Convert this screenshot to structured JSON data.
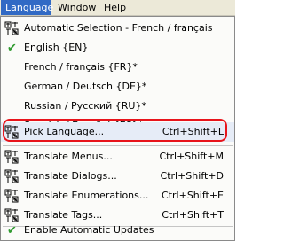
{
  "menubar": {
    "items": [
      "Language",
      "Window",
      "Help"
    ]
  },
  "menu": {
    "items": [
      {
        "icon": "language-icon",
        "label": "Automatic Selection - French / français",
        "shortcut": ""
      },
      {
        "icon": "check-icon",
        "label": "English  {EN}",
        "shortcut": ""
      },
      {
        "icon": "",
        "label": "French / français  {FR}*",
        "shortcut": ""
      },
      {
        "icon": "",
        "label": "German / Deutsch  {DE}*",
        "shortcut": ""
      },
      {
        "icon": "",
        "label": "Russian / Русский  {RU}*",
        "shortcut": ""
      },
      {
        "icon": "",
        "label": "Spanish / Español  {ES}*",
        "shortcut": ""
      },
      {
        "icon": "language-icon",
        "label": "Pick Language...",
        "shortcut": "Ctrl+Shift+L"
      },
      {
        "icon": "language-icon",
        "label": "Translate Menus...",
        "shortcut": "Ctrl+Shift+M"
      },
      {
        "icon": "language-icon",
        "label": "Translate Dialogs...",
        "shortcut": "Ctrl+Shift+D"
      },
      {
        "icon": "language-icon",
        "label": "Translate Enumerations...",
        "shortcut": "Ctrl+Shift+E"
      },
      {
        "icon": "language-icon",
        "label": "Translate Tags...",
        "shortcut": "Ctrl+Shift+T"
      },
      {
        "icon": "check-icon",
        "label": "Enable Automatic Updates",
        "shortcut": ""
      }
    ]
  },
  "colors": {
    "menubar_bg": "#ece9d8",
    "active_menu_bg": "#316ac5",
    "highlight_border": "#e8141b",
    "check": "#2f9a2f"
  }
}
